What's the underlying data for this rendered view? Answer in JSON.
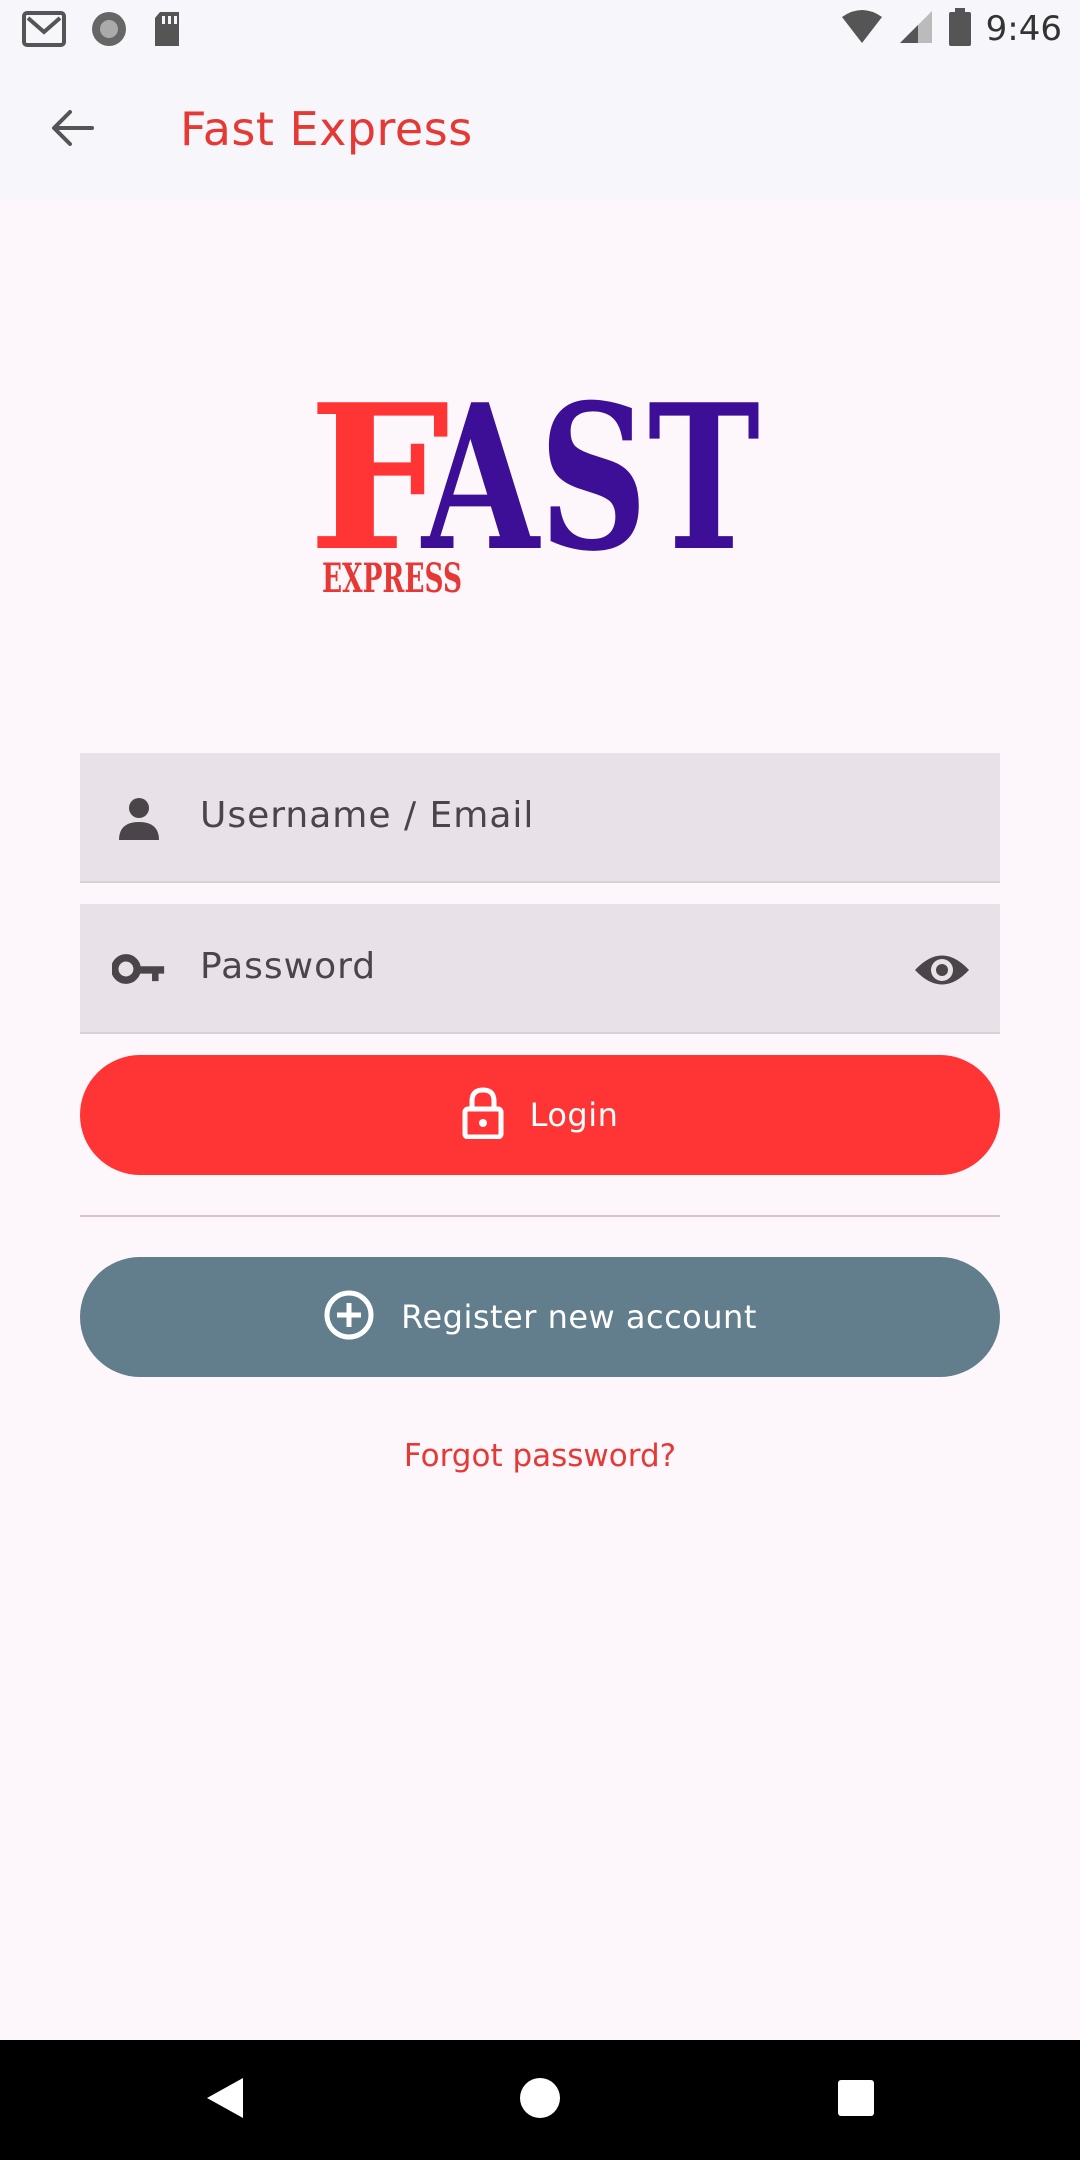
{
  "status_bar": {
    "time": "9:46",
    "left_icons": [
      "gmail-icon",
      "record-icon",
      "sd-card-icon"
    ],
    "right_icons": [
      "wifi-icon",
      "cell-signal-icon",
      "battery-icon"
    ]
  },
  "app_bar": {
    "title": "Fast Express",
    "back_icon": "arrow-back-icon"
  },
  "logo": {
    "main_text_red": "F",
    "main_text_blue": "AST",
    "sub_text": "EXPRESS"
  },
  "form": {
    "username_placeholder": "Username / Email",
    "password_placeholder": "Password",
    "login_label": "Login",
    "register_label": "Register new account",
    "forgot_label": "Forgot password?"
  },
  "colors": {
    "accent_red": "#e53935",
    "login_button": "#ff3434",
    "register_button": "#627d8b",
    "logo_blue": "#3d0f96",
    "field_bg": "#e8e1e8"
  },
  "nav_bar": {
    "icons": [
      "back-triangle-icon",
      "home-circle-icon",
      "recents-square-icon"
    ]
  }
}
